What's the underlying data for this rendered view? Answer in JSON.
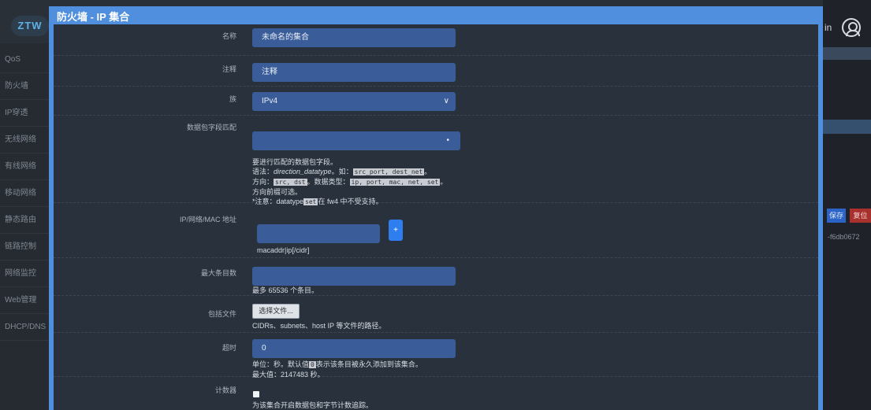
{
  "background": {
    "logo": "ZTW",
    "sidebar": [
      "QoS",
      "防火墙",
      "IP穿透",
      "无线网络",
      "有线网络",
      "移动网络",
      "静态路由",
      "链路控制",
      "网络监控",
      "Web管理",
      "DHCP/DNS"
    ],
    "user_text": "in",
    "save_label": "保存",
    "reset_label": "复位",
    "hash_text": "-f6db0672"
  },
  "modal": {
    "title": "防火墙 - IP 集合",
    "fields": {
      "name": {
        "label": "名称",
        "value": "未命名的集合"
      },
      "comment": {
        "label": "注释",
        "value": "注释"
      },
      "family": {
        "label": "族",
        "value": "IPv4"
      },
      "match": {
        "label": "数据包字段匹配",
        "hint_line1": "要进行匹配的数据包字段。",
        "hint_line2_pre": "语法：",
        "hint_line2_em": "direction_datatype",
        "hint_line2_mid": "。如：",
        "hint_line2_code": "src_port, dest_net",
        "hint_line2_post": "。",
        "hint_line3_pre": "方向：",
        "hint_line3_code1": "src, dst",
        "hint_line3_mid": "。数据类型：",
        "hint_line3_code2": "ip, port, mac, net, set",
        "hint_line3_post": "。",
        "hint_line4": "方向前缀可选。",
        "hint_line5_pre": "*注意：datatype",
        "hint_line5_code": "set",
        "hint_line5_post": "在 fw4 中不受支持。"
      },
      "address": {
        "label": "IP/网络/MAC 地址",
        "add_label": "+",
        "hint": "macaddr|ip[/cidr]"
      },
      "maxelem": {
        "label": "最大条目数",
        "hint": "最多 65536 个条目。"
      },
      "include": {
        "label": "包括文件",
        "button": "选择文件...",
        "hint": "CIDRs、subnets、host IP 等文件的路径。"
      },
      "timeout": {
        "label": "超时",
        "value": "0",
        "hint_pre": "单位：秒。默认值",
        "hint_code": "0",
        "hint_post": "表示该条目被永久添加到该集合。",
        "hint_line2": "最大值：2147483 秒。"
      },
      "counters": {
        "label": "计数器",
        "hint": "为该集合开启数据包和字节计数追踪。"
      }
    }
  }
}
